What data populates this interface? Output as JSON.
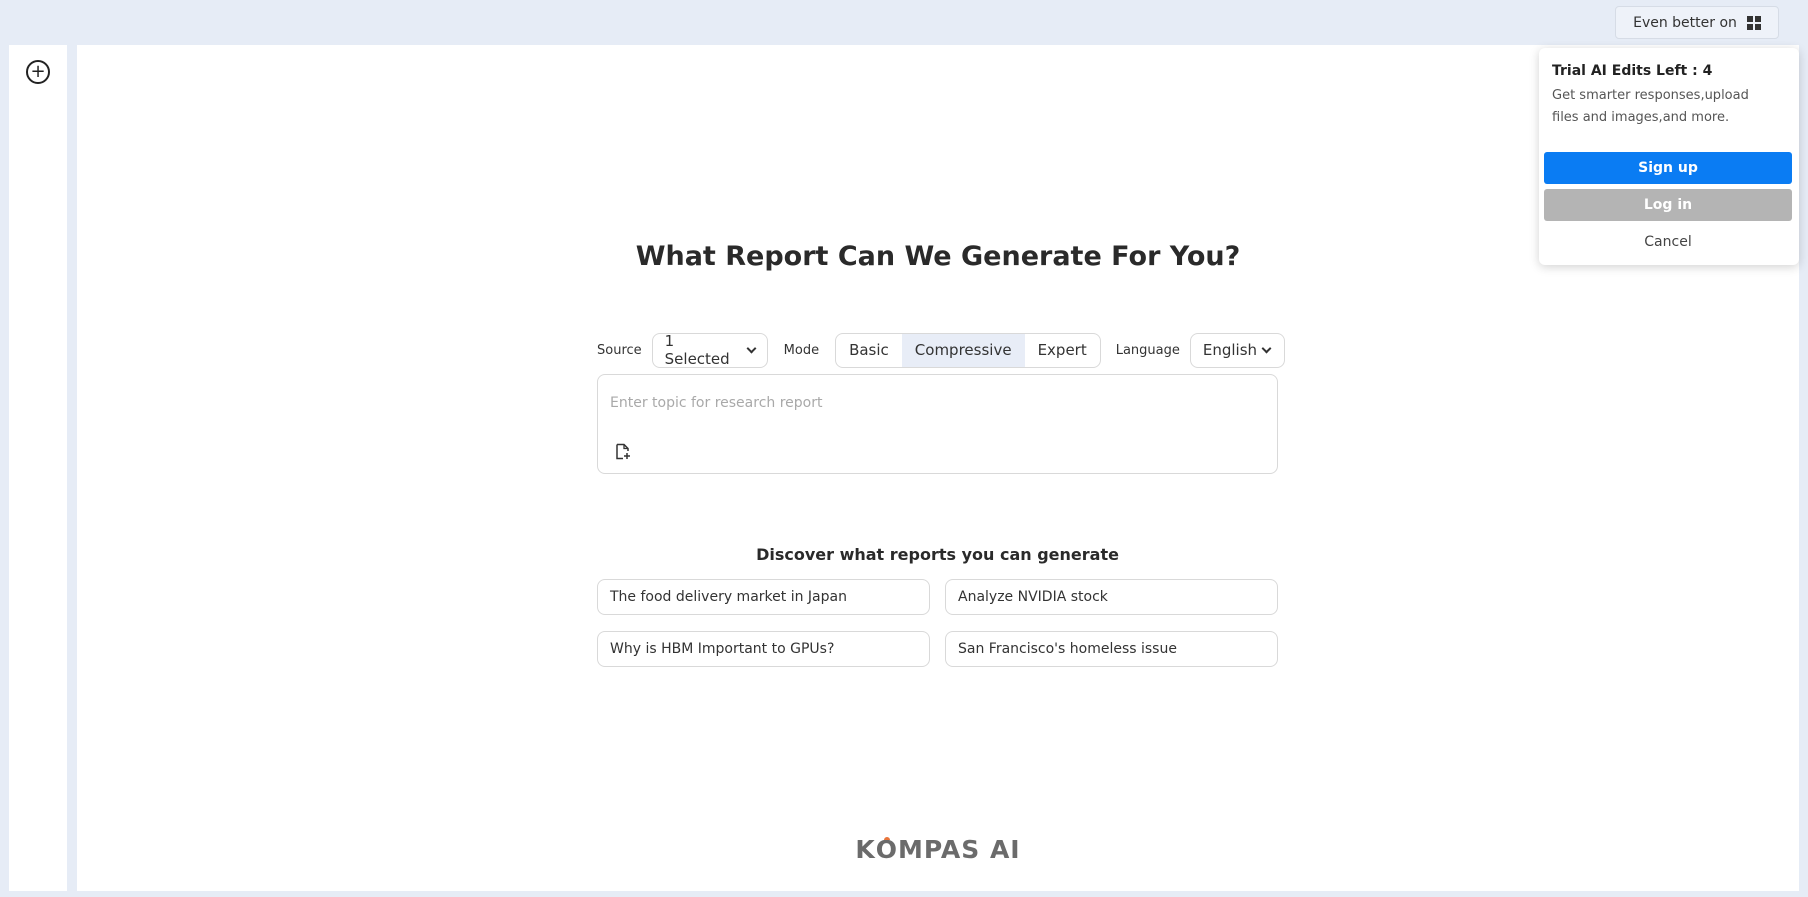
{
  "header": {
    "promo_label": "Even better on",
    "promo_icon": "windows-icon"
  },
  "sidebar": {
    "new_icon": "plus-circle-icon"
  },
  "main": {
    "headline": "What Report Can We Generate For You?",
    "controls": {
      "source_label": "Source",
      "source_value": "1 Selected",
      "mode_label": "Mode",
      "modes": [
        "Basic",
        "Compressive",
        "Expert"
      ],
      "active_mode": "Compressive",
      "language_label": "Language",
      "language_value": "English"
    },
    "topic": {
      "placeholder": "Enter topic for research report",
      "attach_icon": "file-add-icon"
    },
    "discover": {
      "title": "Discover what reports you can generate",
      "suggestions": [
        "The food delivery market in Japan",
        "Analyze NVIDIA stock",
        "Why is HBM Important to GPUs?",
        "San Francisco's homeless issue"
      ]
    },
    "brand": {
      "left": "K",
      "o": "O",
      "right": "MPAS AI"
    }
  },
  "popup": {
    "title": "Trial AI Edits Left : 4",
    "description": "Get smarter responses,upload files and images,and more.",
    "signup_label": "Sign up",
    "login_label": "Log in",
    "cancel_label": "Cancel"
  },
  "colors": {
    "accent": "#0a7cf3",
    "login_bg": "#b4b4b4",
    "page_bg": "#e6ecf6",
    "brand_dot": "#e8743a"
  }
}
